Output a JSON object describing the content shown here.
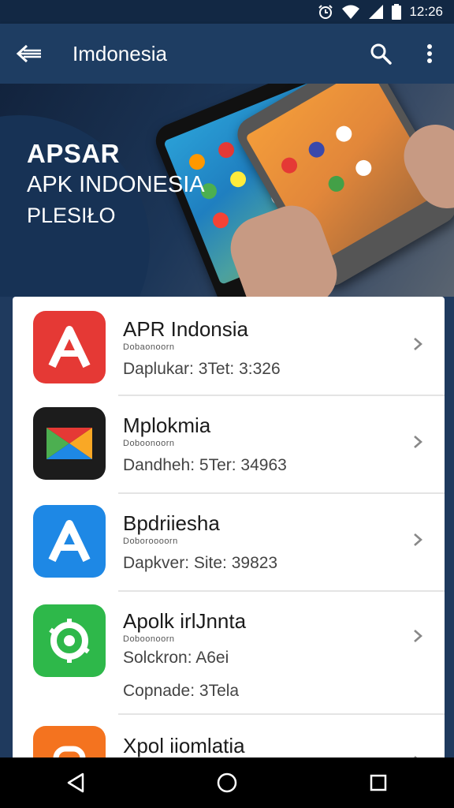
{
  "status_bar": {
    "time": "12:26",
    "icons": [
      "alarm-icon",
      "wifi-icon",
      "signal-icon",
      "battery-icon"
    ]
  },
  "app_bar": {
    "title": "Imdonesia",
    "icons": [
      "back-arrow-icon",
      "search-icon",
      "more-vert-icon"
    ]
  },
  "banner": {
    "line1": "APSAR",
    "line2": "APK INDONESIA",
    "line3": "PLESIŁO"
  },
  "apps": [
    {
      "name": "APR Indonsia",
      "subtitle": "Dobaonoorn",
      "meta": [
        "Daplukar: 3Tet: 3:326"
      ],
      "icon": "red-a-icon",
      "color": "#e53935"
    },
    {
      "name": "Mplokmia",
      "subtitle": "Doboonoorn",
      "meta": [
        "Dandheh: 5Ter: 34963"
      ],
      "icon": "colorful-arrow-icon",
      "color": "#1c1c1c"
    },
    {
      "name": "Bpdriiesha",
      "subtitle": "Doboroooorn",
      "meta": [
        "Dapkver: Site: 39823"
      ],
      "icon": "blue-a-icon",
      "color": "#1e88e5"
    },
    {
      "name": "Apolk irlJnnta",
      "subtitle": "Doboonoorn",
      "meta": [
        "Solckron: A6ei",
        "Copnade: 3Tela"
      ],
      "icon": "green-gear-icon",
      "color": "#2eb84a"
    },
    {
      "name": "Xpol iiomlatia",
      "subtitle": "",
      "meta": [],
      "icon": "orange-app-icon",
      "color": "#f4731f"
    }
  ],
  "nav_bar": {
    "icons": [
      "back-triangle-icon",
      "home-circle-icon",
      "recents-square-icon"
    ]
  },
  "colors": {
    "app_bar": "#1e3d62",
    "status_bar": "#122844",
    "hero": "#1c3658"
  }
}
